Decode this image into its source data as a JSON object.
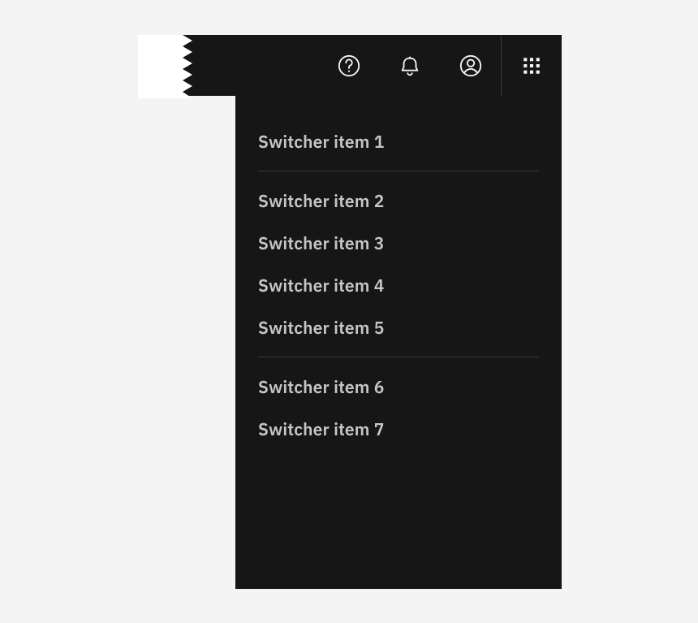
{
  "switcher": {
    "groups": [
      {
        "items": [
          {
            "label": "Switcher item 1"
          }
        ]
      },
      {
        "items": [
          {
            "label": "Switcher item 2"
          },
          {
            "label": "Switcher item 3"
          },
          {
            "label": "Switcher item 4"
          },
          {
            "label": "Switcher item 5"
          }
        ]
      },
      {
        "items": [
          {
            "label": "Switcher item 6"
          },
          {
            "label": "Switcher item 7"
          }
        ]
      }
    ]
  }
}
